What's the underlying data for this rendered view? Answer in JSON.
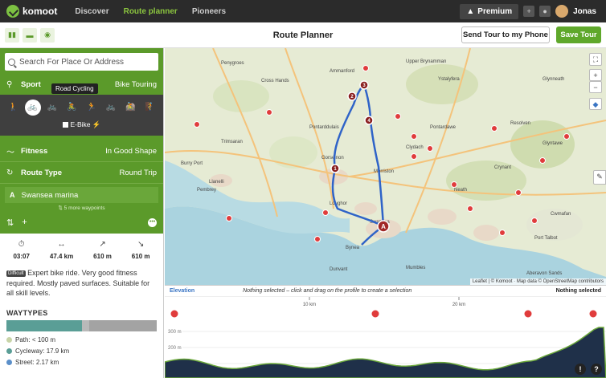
{
  "topbar": {
    "brand": "komoot",
    "nav": [
      "Discover",
      "Route planner",
      "Pioneers"
    ],
    "premium_label": "Premium",
    "user_name": "Jonas"
  },
  "subbar": {
    "title": "Route Planner",
    "send_label": "Send Tour to my Phone",
    "save_label": "Save Tour"
  },
  "planner": {
    "search_placeholder": "Search For Place Or Address",
    "sport_label": "Sport",
    "sport_value": "Bike Touring",
    "tooltip": "Road Cycling",
    "ebike_label": "E-Bike",
    "fitness_label": "Fitness",
    "fitness_value": "In Good Shape",
    "route_type_label": "Route Type",
    "route_type_value": "Round Trip",
    "start_letter": "A",
    "start_name": "Swansea marina",
    "more_waypoints": "5 more waypoints"
  },
  "stats": {
    "duration": "03:07",
    "distance": "47.4 km",
    "uphill": "610 m",
    "downhill": "610 m"
  },
  "description": {
    "badge": "Difficult",
    "text": "Expert bike ride. Very good fitness required. Mostly paved surfaces. Suitable for all skill levels."
  },
  "waytypes": {
    "title": "WAYTYPES",
    "segments": [
      {
        "color": "#5a9e96",
        "fraction": 0.5
      },
      {
        "color": "#b9b9b9",
        "fraction": 0.05
      },
      {
        "color": "#a3a3a3",
        "fraction": 0.45
      }
    ],
    "items": [
      {
        "label": "Path:",
        "value": "< 100 m",
        "color": "#c8d4a8"
      },
      {
        "label": "Cycleway:",
        "value": "17.9 km",
        "color": "#5a9e96"
      },
      {
        "label": "Street:",
        "value": "2.17 km",
        "color": "#5b8fc9"
      }
    ]
  },
  "map": {
    "attribution": "Leaflet | © Komoot · Map data © OpenStreetMap contributors",
    "towns": [
      "Penygroes",
      "Cross Hands",
      "Ammanford",
      "Upper Brynamman",
      "Ystalyfera",
      "Pontarddulais",
      "Gorseinon",
      "Morriston",
      "Clydach",
      "Burry Port",
      "Llanelli",
      "Neath",
      "Swansea",
      "Port Talbot",
      "Cwmafan",
      "Glynneath",
      "Resolven",
      "Aberavon Sands",
      "Crynant",
      "Glyntawe",
      "Pontardawe",
      "Bynea",
      "Loughor",
      "Trimsaran",
      "Pembrey",
      "Dunvant",
      "Mumbles"
    ],
    "waypoints": [
      "A",
      "1",
      "2",
      "3",
      "4"
    ],
    "route_color": "#2f63c8"
  },
  "elevation": {
    "title": "Elevation",
    "hint": "Nothing selected – click and drag on the profile to create a selection",
    "status": "Nothing selected",
    "x_ticks": [
      "10 km",
      "20 km"
    ],
    "y_ticks": [
      "300 m",
      "200 m",
      "100 m"
    ]
  }
}
